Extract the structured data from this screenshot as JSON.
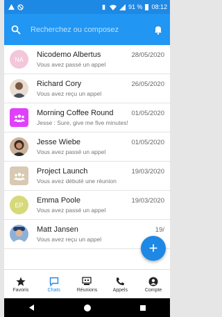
{
  "status": {
    "battery": "91 %",
    "time": "08:12"
  },
  "search": {
    "placeholder": "Recherchez ou composez"
  },
  "conversations": [
    {
      "name": "Nicodemo Albertus",
      "date": "28/05/2020",
      "preview": "Vous avez passé un appel",
      "initials": "NA",
      "avatar_color": "#f3c6da",
      "avatar_kind": "initials"
    },
    {
      "name": "Richard Cory",
      "date": "26/05/2020",
      "preview": "Vous avez reçu un appel",
      "initials": "",
      "avatar_color": "#7a5a45",
      "avatar_kind": "photo"
    },
    {
      "name": "Morning Coffee Round",
      "date": "01/05/2020",
      "preview": "Jesse : Sure, give me five minutes!",
      "initials": "",
      "avatar_color": "#e040fb",
      "avatar_kind": "group"
    },
    {
      "name": "Jesse Wiebe",
      "date": "01/05/2020",
      "preview": "Vous avez passé un appel",
      "initials": "",
      "avatar_color": "#3a2a22",
      "avatar_kind": "photo"
    },
    {
      "name": "Project Launch",
      "date": "19/03/2020",
      "preview": "Vous avez débuté une réunion",
      "initials": "",
      "avatar_color": "#d8c9b3",
      "avatar_kind": "group"
    },
    {
      "name": "Emma Poole",
      "date": "19/03/2020",
      "preview": "Vous avez passé un appel",
      "initials": "EP",
      "avatar_color": "#d6d97a",
      "avatar_kind": "initials"
    },
    {
      "name": "Matt Jansen",
      "date": "19/",
      "preview": "Vous avez reçu un appel",
      "initials": "",
      "avatar_color": "#8fb0d8",
      "avatar_kind": "photo"
    }
  ],
  "fab": {
    "label": "+"
  },
  "tabs": [
    {
      "label": "Favoris",
      "icon": "star-icon",
      "active": false
    },
    {
      "label": "Chats",
      "icon": "chat-icon",
      "active": true
    },
    {
      "label": "Réunions",
      "icon": "meeting-icon",
      "active": false
    },
    {
      "label": "Appels",
      "icon": "phone-icon",
      "active": false
    },
    {
      "label": "Compte",
      "icon": "account-icon",
      "active": false
    }
  ],
  "colors": {
    "accent": "#2196f3",
    "status_bar": "#1e88e5"
  }
}
